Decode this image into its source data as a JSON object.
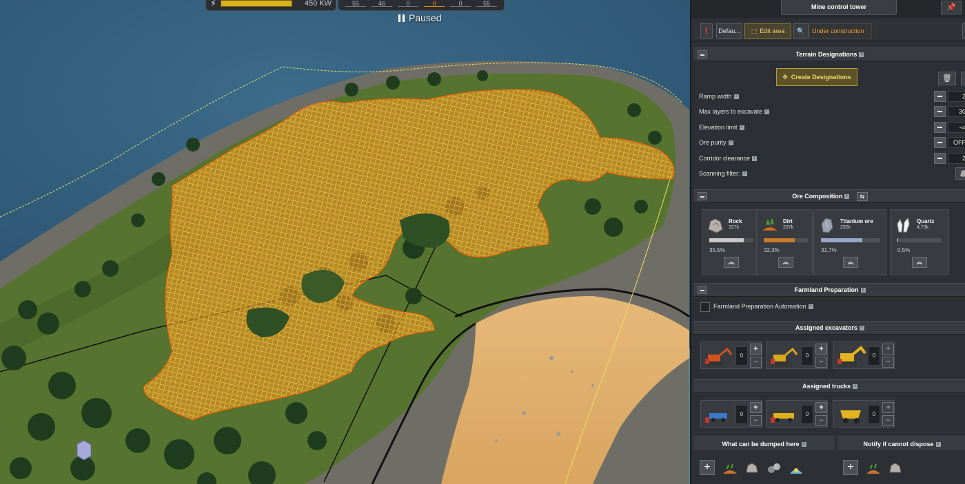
{
  "hud": {
    "power_value": "450 KW",
    "resources": [
      "55",
      "46",
      "0",
      "0",
      "0",
      "55"
    ],
    "paused_label": "Paused"
  },
  "panel": {
    "title": "Mine control tower",
    "toolbar": {
      "priority_icon": "priority-icon",
      "default_label": "Defau...",
      "edit_area_label": "Edit area",
      "status": "Under construction"
    },
    "terrain": {
      "heading": "Terrain Designations",
      "create_label": "Create Designations",
      "params": [
        {
          "label": "Ramp width",
          "value": "2"
        },
        {
          "label": "Max layers to excavate",
          "value": "30"
        },
        {
          "label": "Elevation limit",
          "value": "-∞"
        },
        {
          "label": "Ore purity",
          "value": "OFF"
        },
        {
          "label": "Corridor clearance",
          "value": "2"
        }
      ],
      "scanning_label": "Scanning filter:"
    },
    "ore": {
      "heading": "Ore Composition",
      "items": [
        {
          "name": "Rock",
          "amount": "327k",
          "percent": "35,5%",
          "fill": 0.355,
          "color": "#c9c9c9"
        },
        {
          "name": "Dirt",
          "amount": "297k",
          "percent": "32,3%",
          "fill": 0.323,
          "color": "#c87a2a"
        },
        {
          "name": "Titanium ore",
          "amount": "292k",
          "percent": "31,7%",
          "fill": 0.317,
          "color": "#9aa4c8"
        },
        {
          "name": "Quartz",
          "amount": "4,73k",
          "percent": "0,5%",
          "fill": 0.005,
          "color": "#dddddd"
        }
      ]
    },
    "farmland": {
      "heading": "Farmland Preparation",
      "automation_label": "Farmland Preparation Automation"
    },
    "excavators": {
      "heading": "Assigned excavators",
      "counts": [
        "0",
        "0",
        "0"
      ]
    },
    "trucks": {
      "heading": "Assigned trucks",
      "counts": [
        "0",
        "0",
        "0"
      ]
    },
    "dump": {
      "heading": "What can be dumped here",
      "notify_heading": "Notify if cannot dispose"
    }
  },
  "colors": {
    "accent": "#f2db76",
    "status": "#e9a23b",
    "designation": "#f59a1a"
  }
}
